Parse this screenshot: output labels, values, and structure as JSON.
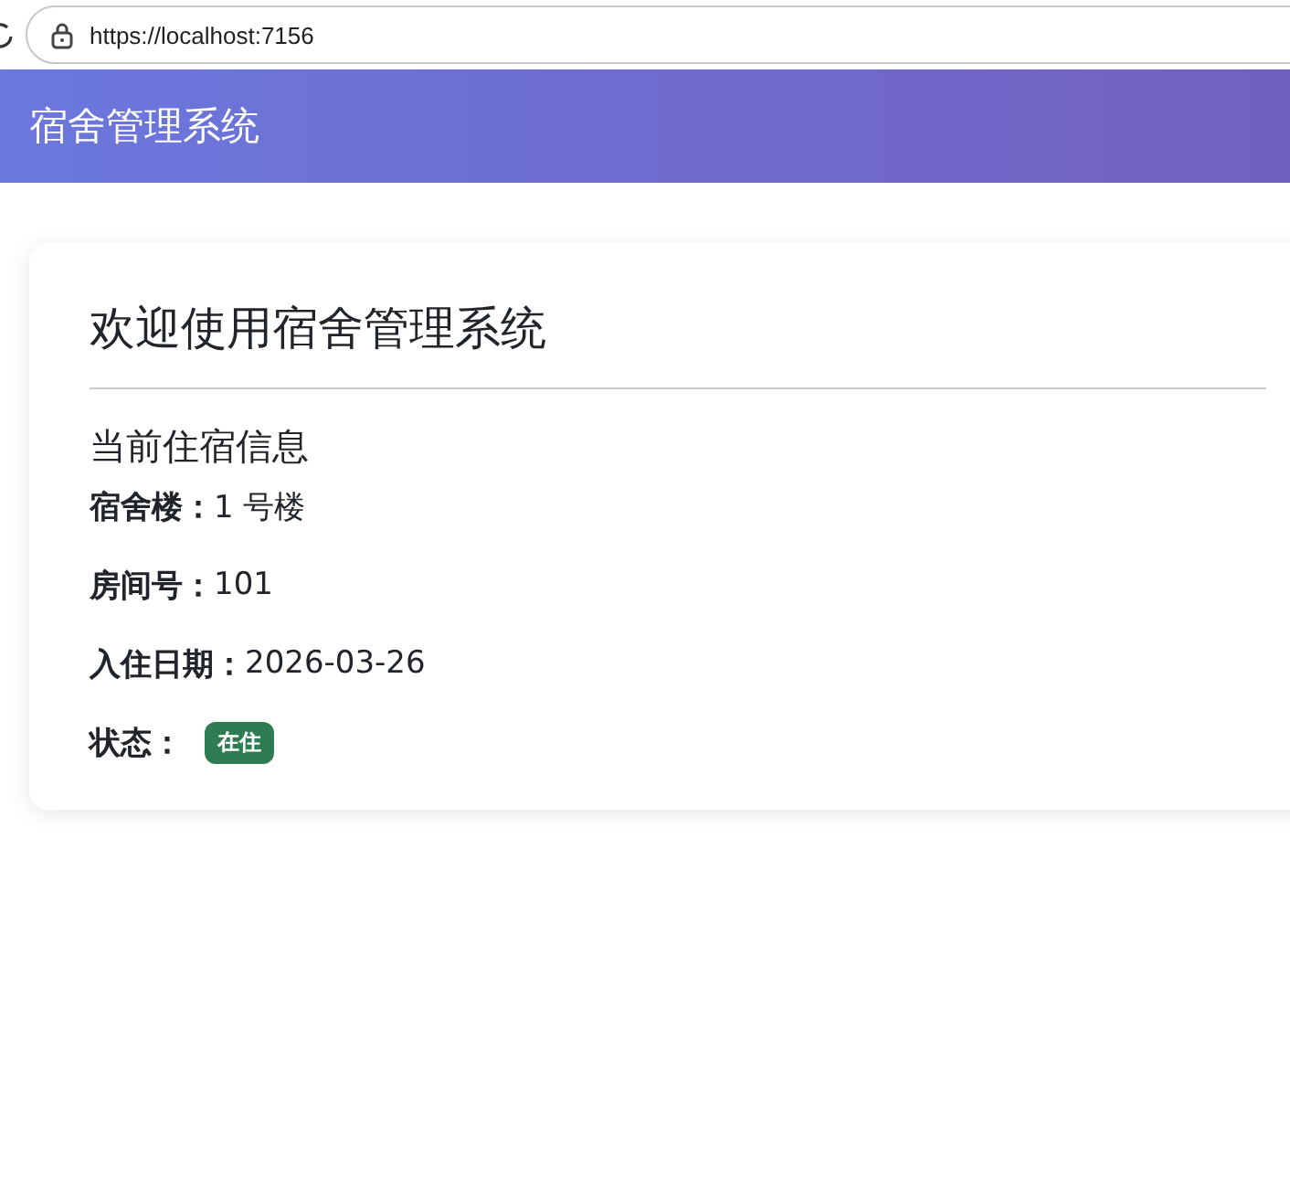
{
  "browser": {
    "url": "https://localhost:7156"
  },
  "header": {
    "title": "宿舍管理系统"
  },
  "card": {
    "title": "欢迎使用宿舍管理系统",
    "section_title": "当前住宿信息",
    "fields": [
      {
        "kind": "text",
        "label": "宿舍楼：",
        "value": "1 号楼"
      },
      {
        "kind": "text",
        "label": "房间号：",
        "value": "101"
      },
      {
        "kind": "text",
        "label": "入住日期：",
        "value": "2026-03-26"
      },
      {
        "kind": "badge",
        "label": "状态：",
        "value": "在住",
        "color": "#2e7d52"
      }
    ]
  }
}
